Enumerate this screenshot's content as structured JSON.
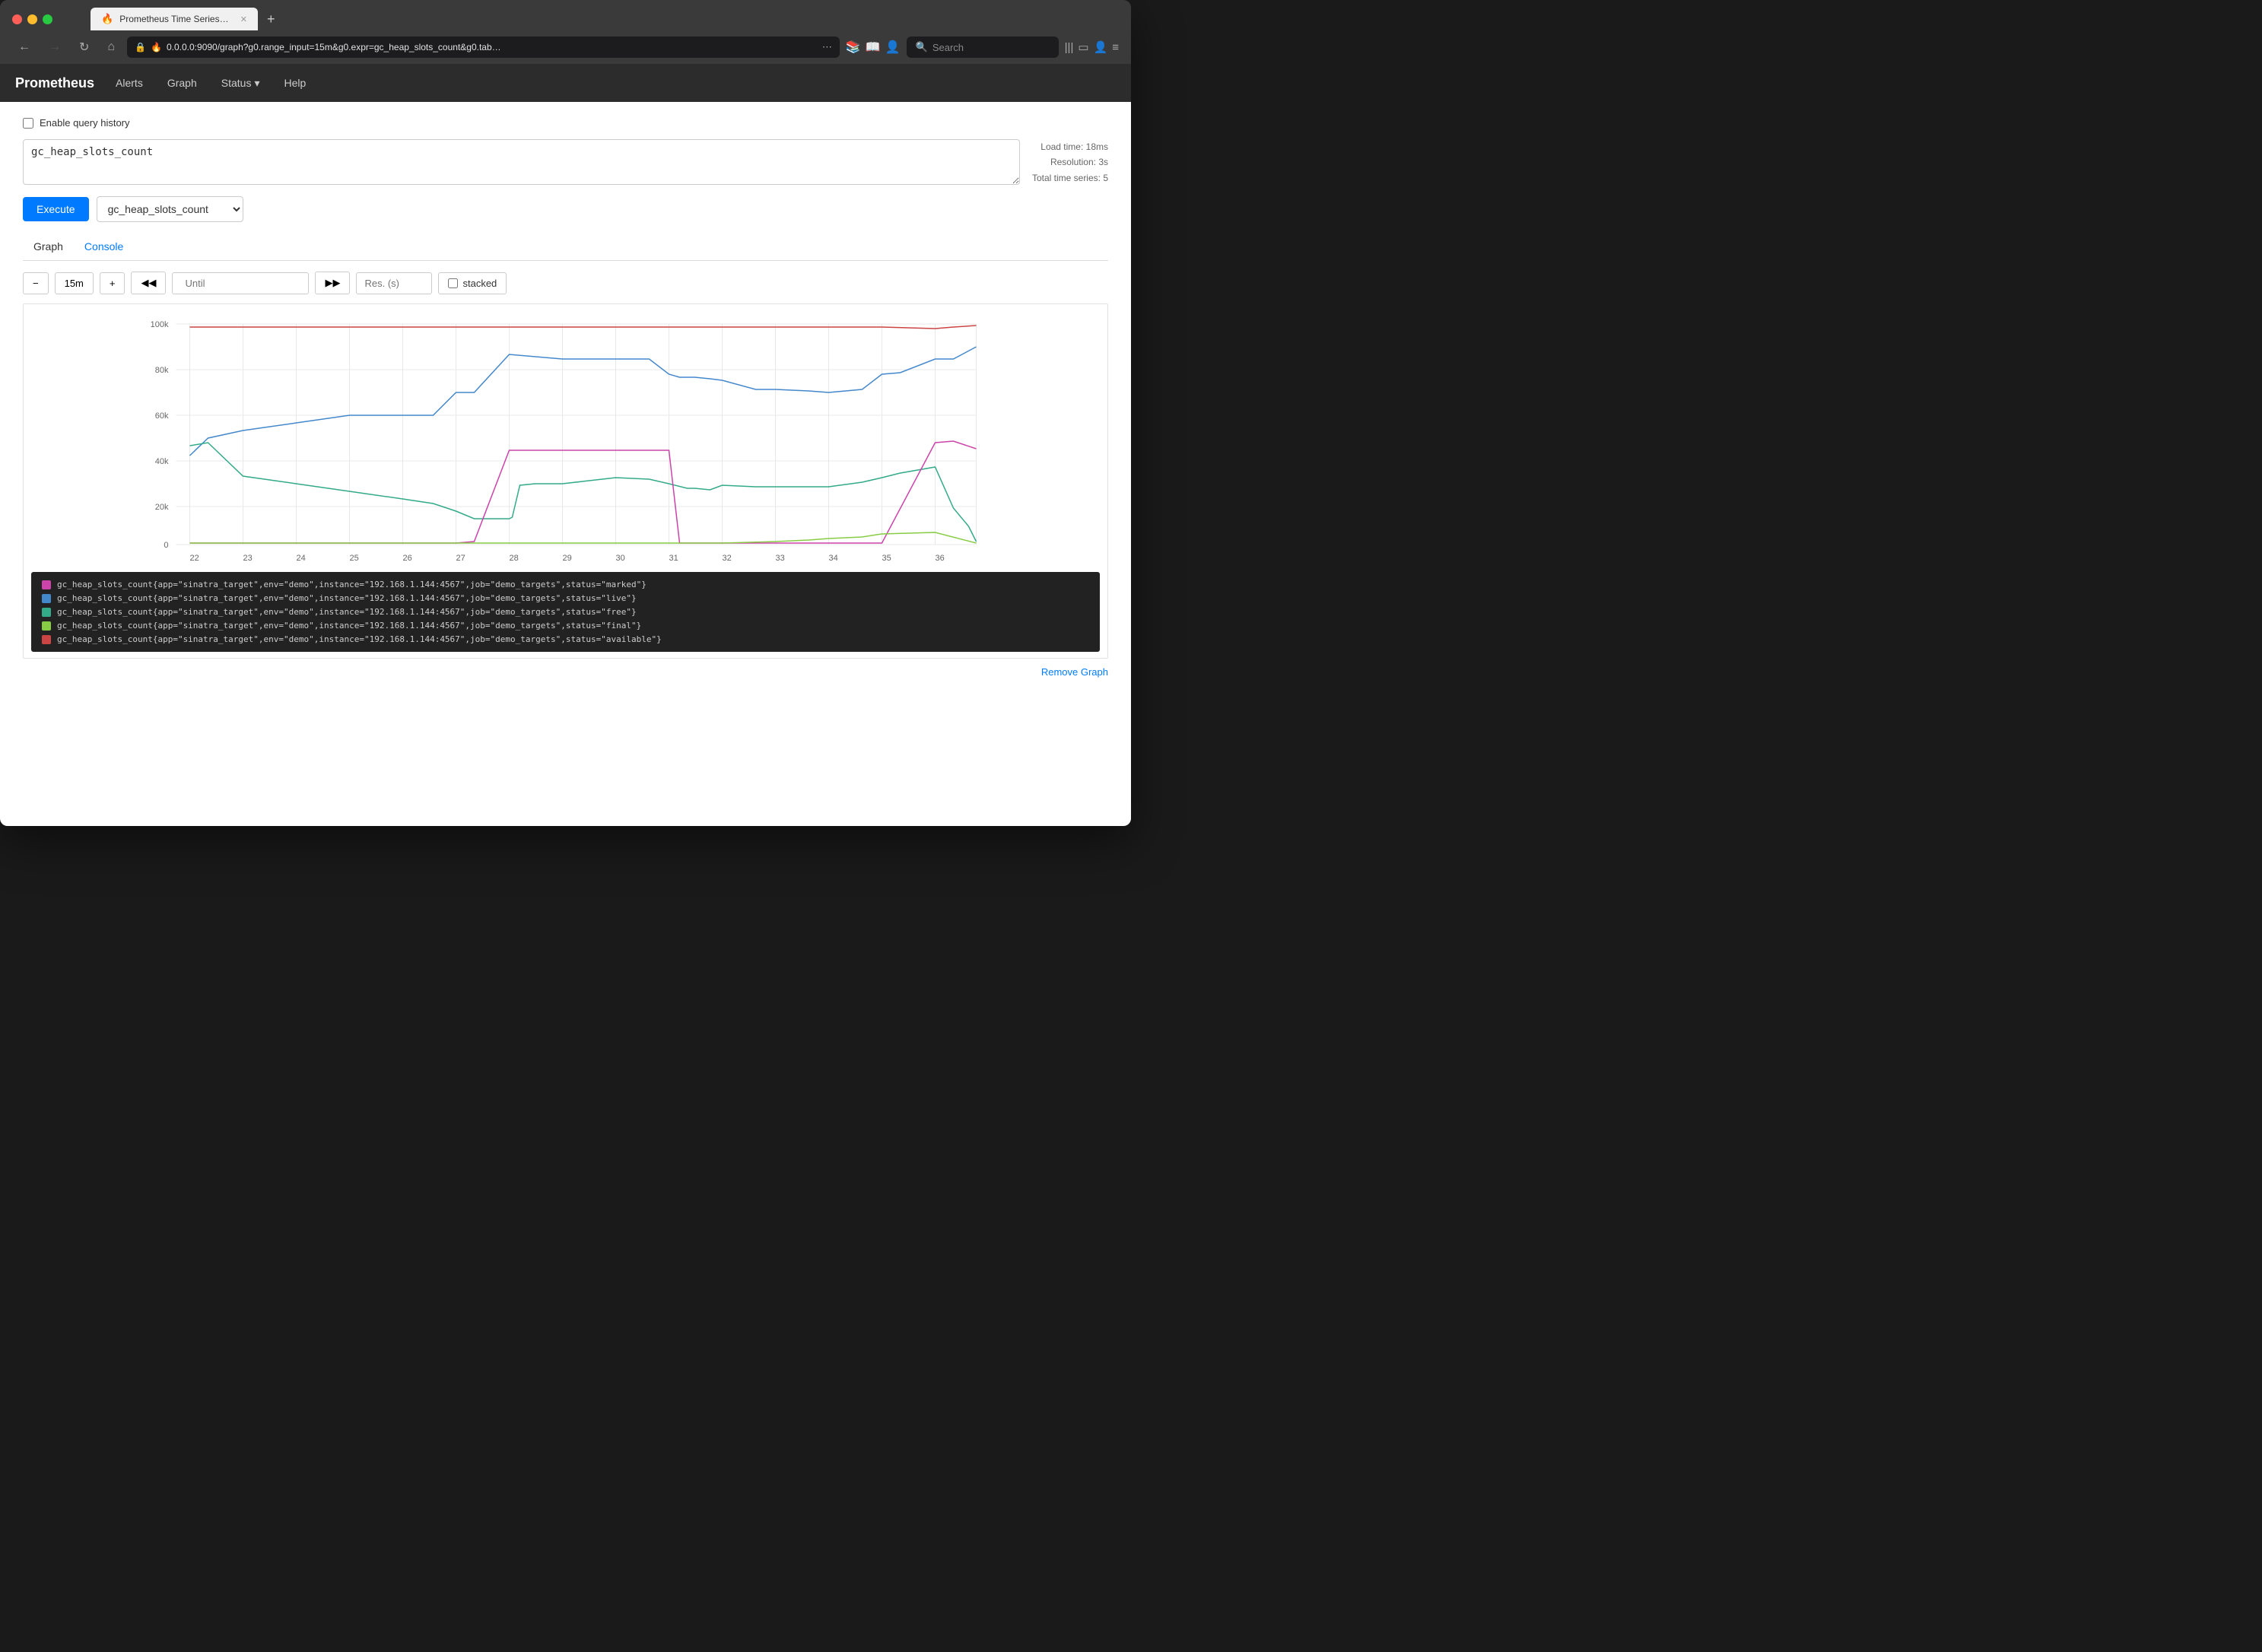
{
  "browser": {
    "tab_title": "Prometheus Time Series Collec…",
    "url": "0.0.0.0:9090/graph?g0.range_input=15m&g0.expr=gc_heap_slots_count&g0.tab…",
    "search_placeholder": "Search",
    "new_tab_label": "+",
    "nav_back": "←",
    "nav_forward": "→",
    "nav_reload": "↻",
    "nav_home": "⌂"
  },
  "prometheus": {
    "brand": "Prometheus",
    "nav_links": [
      "Alerts",
      "Graph",
      "Status",
      "Help"
    ],
    "status_has_dropdown": true
  },
  "page": {
    "query_history_label": "Enable query history",
    "query_value": "gc_heap_slots_count",
    "execute_label": "Execute",
    "expr_select_value": "gc_heap_slots_count",
    "load_time": "Load time: 18ms",
    "resolution": "Resolution: 3s",
    "total_time_series": "Total time series: 5",
    "tab_graph": "Graph",
    "tab_console": "Console",
    "ctrl_minus": "−",
    "ctrl_range": "15m",
    "ctrl_plus": "+",
    "ctrl_back": "◀◀",
    "ctrl_until": "Until",
    "ctrl_forward": "▶▶",
    "ctrl_res_placeholder": "Res. (s)",
    "ctrl_stacked": "stacked",
    "remove_graph": "Remove Graph"
  },
  "chart": {
    "y_labels": [
      "100k",
      "80k",
      "60k",
      "40k",
      "20k",
      "0"
    ],
    "x_labels": [
      "22",
      "23",
      "24",
      "25",
      "26",
      "27",
      "28",
      "29",
      "30",
      "31",
      "32",
      "33",
      "34",
      "35",
      "36"
    ],
    "series": [
      {
        "color": "#cc44aa",
        "status": "marked"
      },
      {
        "color": "#4488cc",
        "status": "live"
      },
      {
        "color": "#33aa88",
        "status": "free"
      },
      {
        "color": "#88cc44",
        "status": "final"
      },
      {
        "color": "#cc4444",
        "status": "available"
      }
    ]
  },
  "legend": {
    "items": [
      {
        "color": "#cc44aa",
        "label": "gc_heap_slots_count{app=\"sinatra_target\",env=\"demo\",instance=\"192.168.1.144:4567\",job=\"demo_targets\",status=\"marked\"}"
      },
      {
        "color": "#4488cc",
        "label": "gc_heap_slots_count{app=\"sinatra_target\",env=\"demo\",instance=\"192.168.1.144:4567\",job=\"demo_targets\",status=\"live\"}"
      },
      {
        "color": "#33aa88",
        "label": "gc_heap_slots_count{app=\"sinatra_target\",env=\"demo\",instance=\"192.168.1.144:4567\",job=\"demo_targets\",status=\"free\"}"
      },
      {
        "color": "#88cc44",
        "label": "gc_heap_slots_count{app=\"sinatra_target\",env=\"demo\",instance=\"192.168.1.144:4567\",job=\"demo_targets\",status=\"final\"}"
      },
      {
        "color": "#cc4444",
        "label": "gc_heap_slots_count{app=\"sinatra_target\",env=\"demo\",instance=\"192.168.1.144:4567\",job=\"demo_targets\",status=\"available\"}"
      }
    ]
  }
}
